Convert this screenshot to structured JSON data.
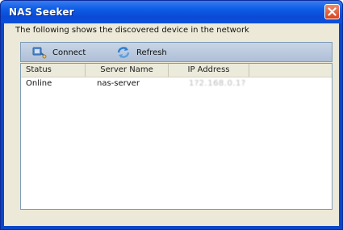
{
  "window": {
    "title": "NAS Seeker"
  },
  "description": "The following shows the discovered device in the network",
  "toolbar": {
    "connect_label": "Connect",
    "connect_icon": "connect-icon",
    "refresh_label": "Refresh",
    "refresh_icon": "refresh-icon"
  },
  "table": {
    "columns": [
      "Status",
      "Server Name",
      "IP Address"
    ],
    "rows": [
      {
        "status": "Online",
        "server_name": "nas-server",
        "ip_address": "1?2.168.0.1?"
      }
    ]
  },
  "colors": {
    "titlebar": "#0a4ad6",
    "client_bg": "#ece9d8",
    "toolbar_bg": "#b8c7db",
    "close_button": "#d8431c"
  }
}
